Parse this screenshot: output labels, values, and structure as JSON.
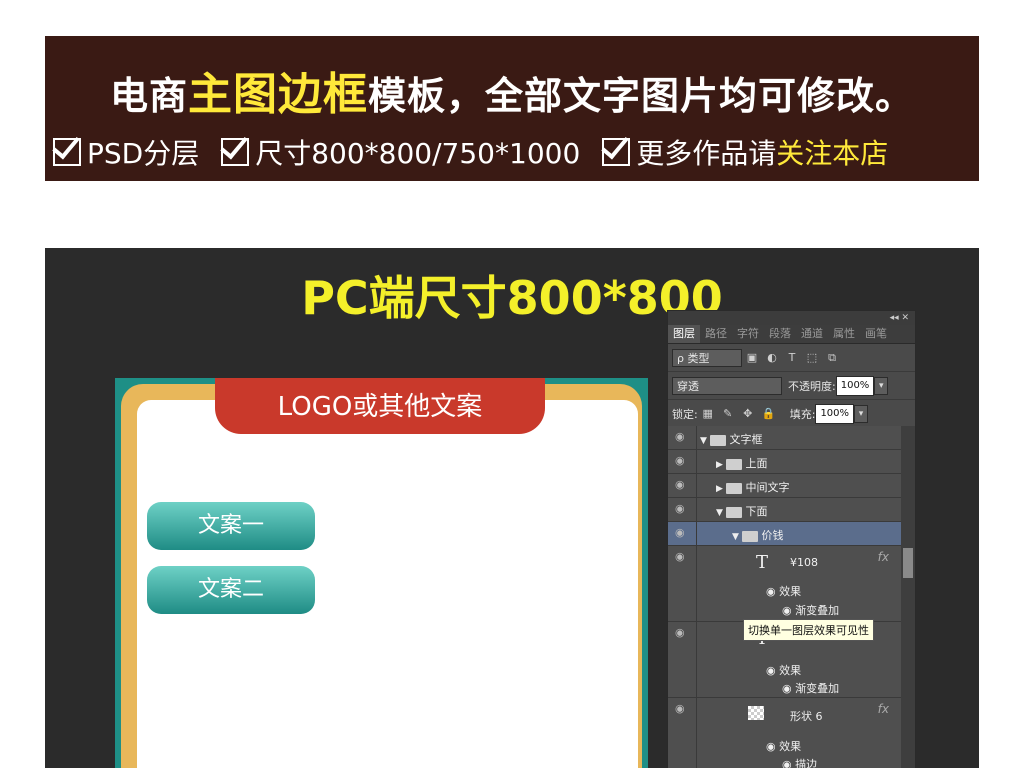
{
  "banner": {
    "headline_a": "电商",
    "headline_b": "主图边框",
    "headline_c": "模板，全部文字图片均可修改。",
    "feature_1": "PSD分层",
    "feature_2": "尺寸800*800/750*1000",
    "feature_3_a": "更多作品请",
    "feature_3_b": "关注本店"
  },
  "preview": {
    "title": "PC端尺寸800*800",
    "logo_text": "LOGO或其他文案",
    "copy_1": "文案一",
    "copy_2": "文案二"
  },
  "ps_panel": {
    "top_icons": "◂◂ ✕",
    "tabs": [
      "图层",
      "路径",
      "字符",
      "段落",
      "通道",
      "属性",
      "画笔"
    ],
    "filter_label": "ρ 类型",
    "blend_mode": "穿透",
    "opacity_label": "不透明度:",
    "opacity_value": "100%",
    "lock_label": "锁定:",
    "fill_label": "填充:",
    "fill_value": "100%",
    "layers": {
      "group_main": "文字框",
      "group_top": "上面",
      "group_mid": "中间文字",
      "group_bottom": "下面",
      "group_price": "价钱",
      "text_price": "¥108",
      "effect_1": "效果",
      "effect_1_sub": "渐变叠加",
      "effect_2": "效果",
      "effect_2_sub": "渐变叠加",
      "shape": "形状 6",
      "effect_3": "效果",
      "effect_3_sub": "描边",
      "fx": "fx"
    },
    "tooltip": "切换单一图层效果可见性"
  },
  "colors": {
    "banner_bg": "#3a1a14",
    "highlight": "#ffe93a",
    "preview_bg": "#2b2b2b",
    "title_yellow": "#f4f02a",
    "frame_teal": "#1e8f86",
    "frame_gold": "#e8b75a",
    "logo_red": "#c9392b"
  }
}
